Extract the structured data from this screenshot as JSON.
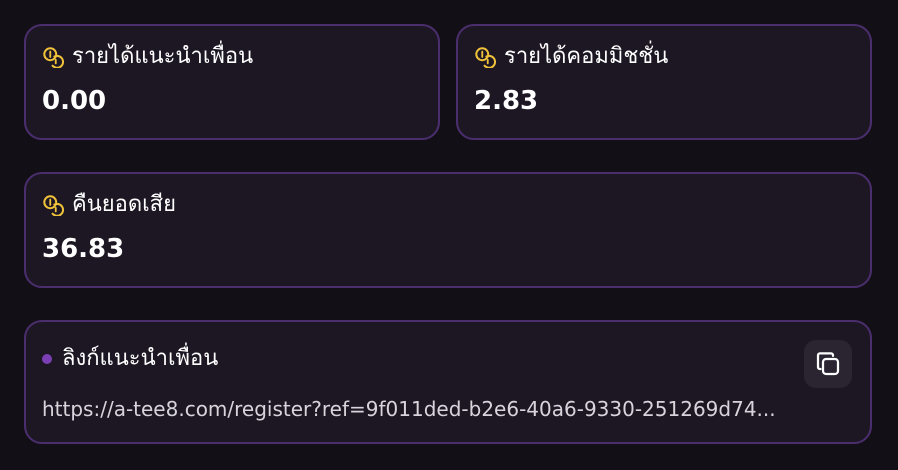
{
  "colors": {
    "background": "#130f17",
    "card": "#1d1724",
    "card_border": "#4a2e6e",
    "coin_icon": "#f0c23a",
    "dot": "#7a3fb5"
  },
  "referral_income": {
    "label": "รายได้แนะนำเพื่อน",
    "value": "0.00",
    "icon": "coins-icon"
  },
  "commission_income": {
    "label": "รายได้คอมมิชชั่น",
    "value": "2.83",
    "icon": "coins-icon"
  },
  "cashback": {
    "label": "คืนยอดเสีย",
    "value": "36.83",
    "icon": "coins-icon"
  },
  "referral_link": {
    "label": "ลิงก์แนะนำเพื่อน",
    "url": "https://a-tee8.com/register?ref=9f011ded-b2e6-40a6-9330-251269d74...",
    "copy_icon": "copy-icon"
  }
}
